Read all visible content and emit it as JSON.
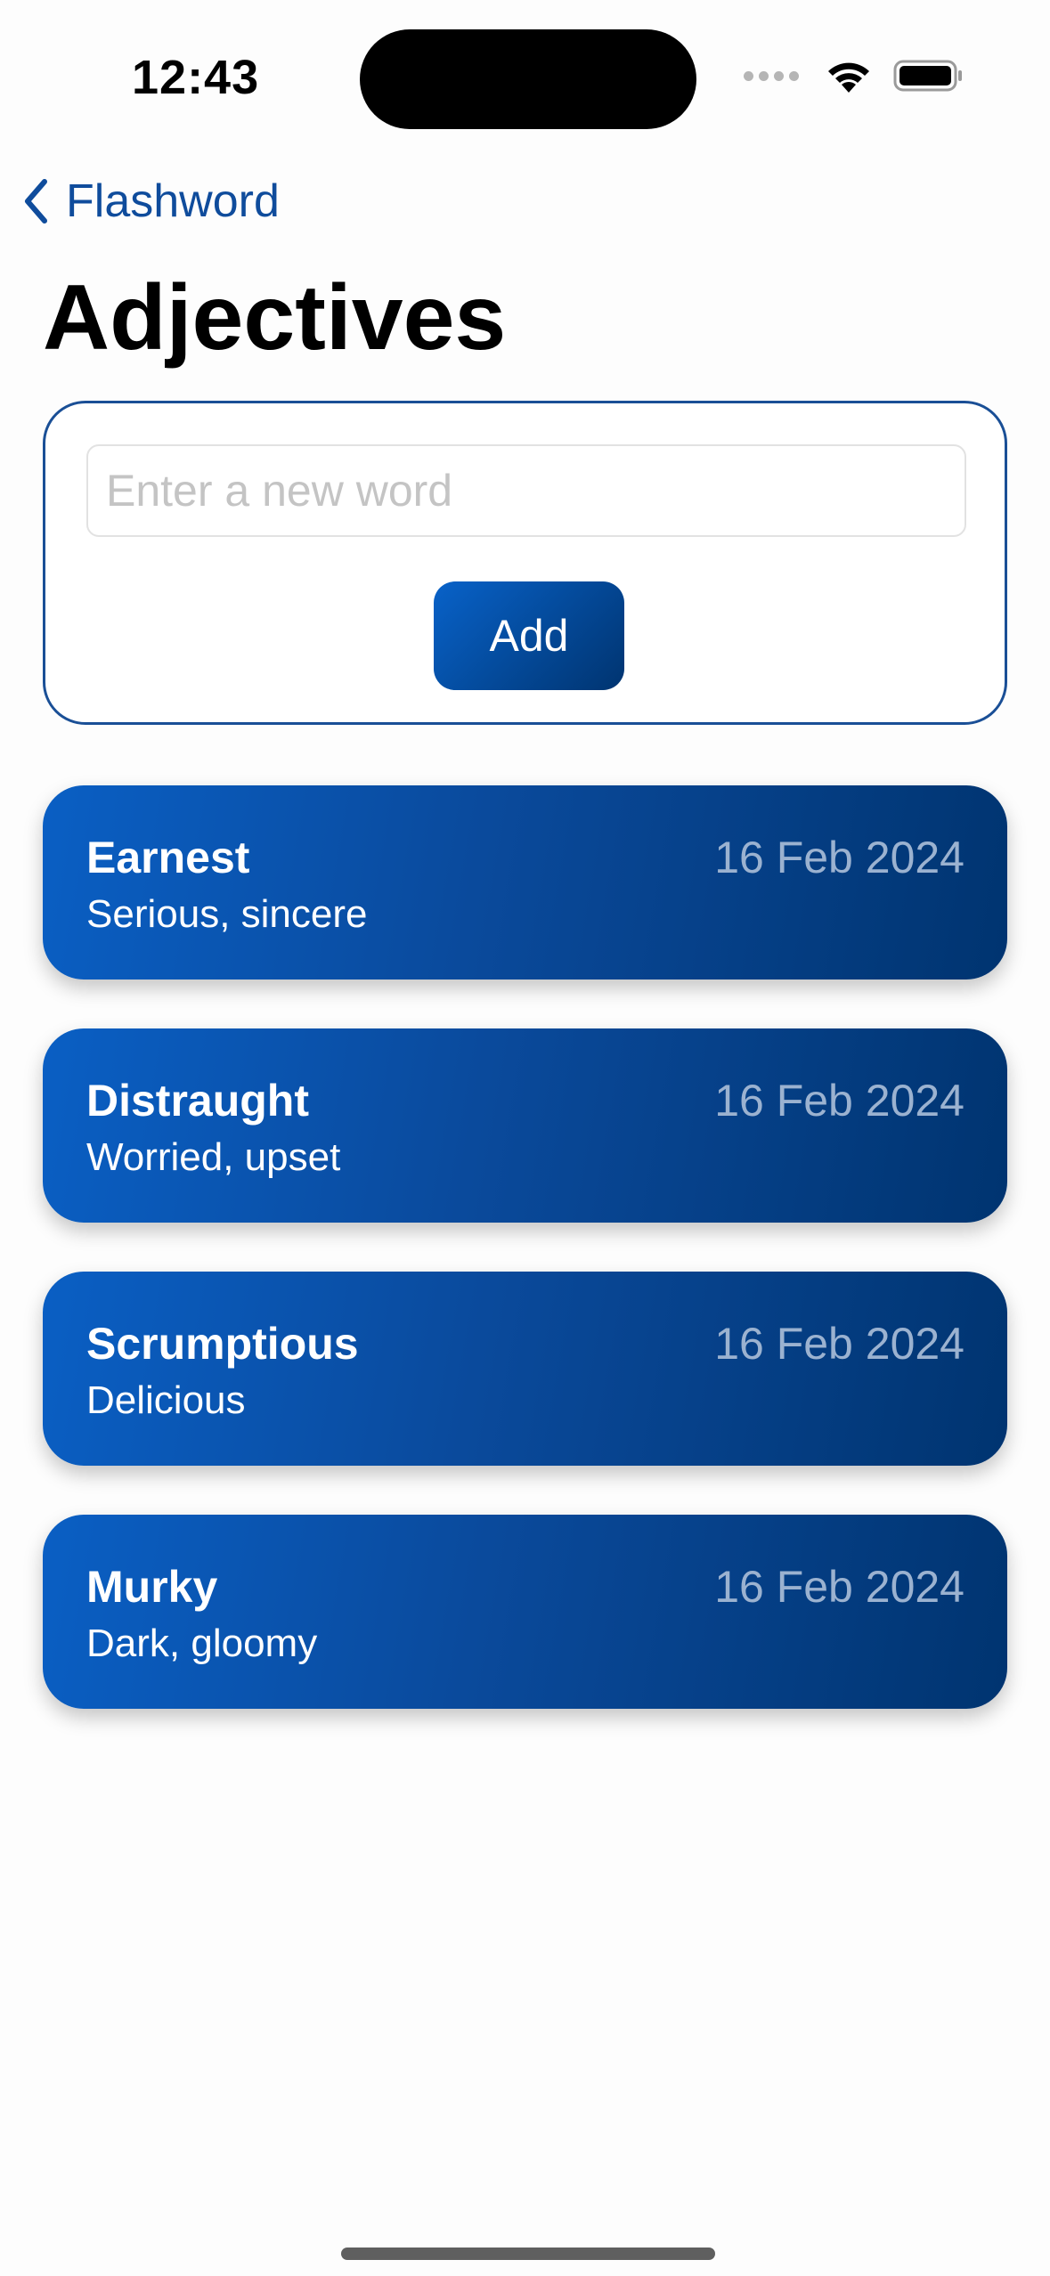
{
  "status_bar": {
    "time": "12:43",
    "icons": [
      "signal-dots-icon",
      "wifi-icon",
      "battery-icon"
    ]
  },
  "nav": {
    "back_label": "Flashword",
    "back_icon": "chevron-left-icon",
    "accent_color": "#0f4c9c"
  },
  "page": {
    "title": "Adjectives"
  },
  "add_form": {
    "input_value": "",
    "input_placeholder": "Enter a new word",
    "add_label": "Add"
  },
  "words": [
    {
      "term": "Earnest",
      "definition": "Serious, sincere",
      "date": "16 Feb 2024"
    },
    {
      "term": "Distraught",
      "definition": "Worried, upset",
      "date": "16 Feb 2024"
    },
    {
      "term": "Scrumptious",
      "definition": "Delicious",
      "date": "16 Feb 2024"
    },
    {
      "term": "Murky",
      "definition": "Dark, gloomy",
      "date": "16 Feb 2024"
    }
  ],
  "colors": {
    "card_gradient_start": "#0a5fc4",
    "card_gradient_end": "#003470",
    "date_text": "#9bb2d0"
  }
}
